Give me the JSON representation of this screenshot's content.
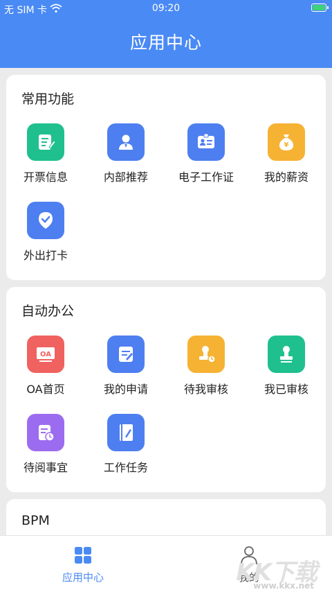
{
  "status_bar": {
    "carrier": "无 SIM 卡",
    "time": "09:20"
  },
  "header": {
    "title": "应用中心"
  },
  "sections": [
    {
      "title": "常用功能",
      "items": [
        {
          "label": "开票信息",
          "icon": "invoice-icon",
          "color": "#1fc08e"
        },
        {
          "label": "内部推荐",
          "icon": "person-recommend-icon",
          "color": "#4e7ff0"
        },
        {
          "label": "电子工作证",
          "icon": "id-card-icon",
          "color": "#4e7ff0"
        },
        {
          "label": "我的薪资",
          "icon": "money-bag-icon",
          "color": "#f6b233"
        },
        {
          "label": "外出打卡",
          "icon": "location-check-icon",
          "color": "#4e7ff0"
        }
      ]
    },
    {
      "title": "自动办公",
      "items": [
        {
          "label": "OA首页",
          "icon": "oa-icon",
          "color": "#f0625f",
          "badge": "OA"
        },
        {
          "label": "我的申请",
          "icon": "edit-doc-icon",
          "color": "#4e7ff0"
        },
        {
          "label": "待我审核",
          "icon": "stamp-clock-icon",
          "color": "#f6b233"
        },
        {
          "label": "我已审核",
          "icon": "stamp-icon",
          "color": "#1fc08e"
        },
        {
          "label": "待阅事宜",
          "icon": "doc-clock-icon",
          "color": "#9c6cf0"
        },
        {
          "label": "工作任务",
          "icon": "notebook-icon",
          "color": "#4e7ff0"
        }
      ]
    },
    {
      "title": "BPM",
      "items": []
    }
  ],
  "tabbar": {
    "tabs": [
      {
        "label": "应用中心",
        "icon": "grid-icon",
        "active": true,
        "color": "#4a8af4"
      },
      {
        "label": "我的",
        "icon": "user-icon",
        "active": false,
        "color": "#666666"
      }
    ]
  },
  "watermark": {
    "text": "KK下载",
    "site": "www.kkx.net"
  }
}
